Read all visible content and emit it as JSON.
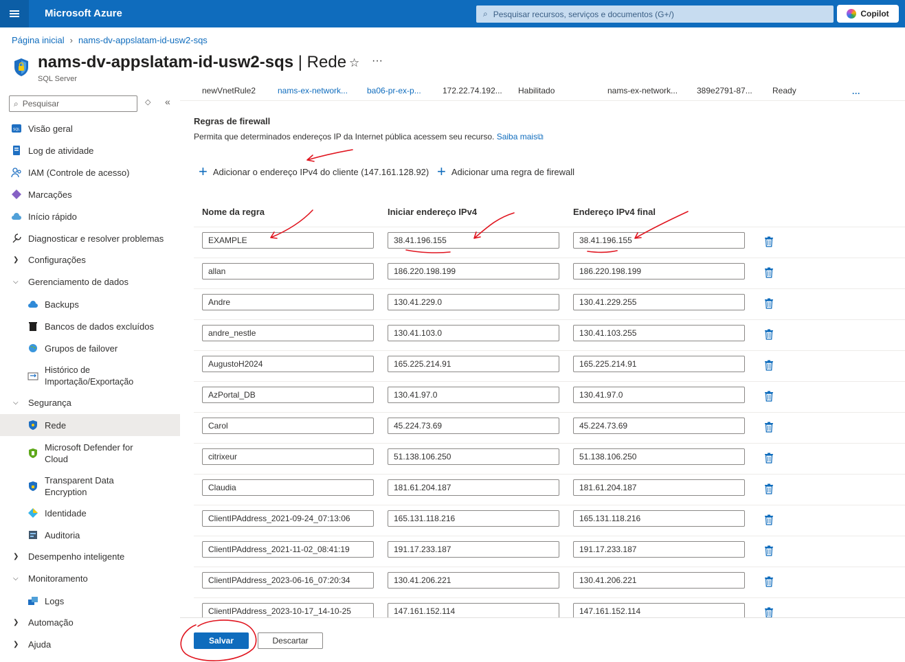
{
  "topbar": {
    "brand": "Microsoft Azure",
    "search_placeholder": "Pesquisar recursos, serviços e documentos (G+/)",
    "copilot_label": "Copilot"
  },
  "breadcrumb": {
    "home": "Página inicial",
    "current": "nams-dv-appslatam-id-usw2-sqs"
  },
  "header": {
    "resource_name": "nams-dv-appslatam-id-usw2-sqs",
    "page_name": "| Rede",
    "subtitle": "SQL Server",
    "star_icon": "☆",
    "more_icon": "···"
  },
  "sidebar": {
    "search_placeholder": "Pesquisar",
    "collapse_icon": "«",
    "items": [
      {
        "label": "Visão geral",
        "icon": "sql-icon"
      },
      {
        "label": "Log de atividade",
        "icon": "log-icon"
      },
      {
        "label": "IAM (Controle de acesso)",
        "icon": "people-icon"
      },
      {
        "label": "Marcações",
        "icon": "tag-icon"
      },
      {
        "label": "Início rápido",
        "icon": "cloud-icon"
      },
      {
        "label": "Diagnosticar e resolver problemas",
        "icon": "wrench-icon"
      },
      {
        "label": "Configurações",
        "icon": "chevron-right-icon"
      },
      {
        "label": "Gerenciamento de dados",
        "icon": "chevron-down-icon"
      },
      {
        "label": "Backups",
        "icon": "cloud-backup-icon"
      },
      {
        "label": "Bancos de dados excluídos",
        "icon": "trash-icon"
      },
      {
        "label": "Grupos de failover",
        "icon": "globe-icon"
      },
      {
        "label": "Histórico de\nImportação/Exportação",
        "icon": "import-export-icon"
      },
      {
        "label": "Segurança",
        "icon": "chevron-down-icon"
      },
      {
        "label": "Rede",
        "icon": "shield-icon"
      },
      {
        "label": "Microsoft Defender for\nCloud",
        "icon": "defender-icon"
      },
      {
        "label": "Transparent Data\nEncryption",
        "icon": "shield-lock-icon"
      },
      {
        "label": "Identidade",
        "icon": "identity-icon"
      },
      {
        "label": "Auditoria",
        "icon": "audit-icon"
      },
      {
        "label": "Desempenho inteligente",
        "icon": "chevron-right-icon"
      },
      {
        "label": "Monitoramento",
        "icon": "chevron-down-icon"
      },
      {
        "label": "Logs",
        "icon": "logs-icon"
      },
      {
        "label": "Automação",
        "icon": "chevron-right-icon"
      },
      {
        "label": "Ajuda",
        "icon": "chevron-right-icon"
      }
    ]
  },
  "vnet_row": {
    "name": "newVnetRule2",
    "vnet": "nams-ex-network...",
    "subnet": "ba06-pr-ex-p...",
    "address": "172.22.74.192...",
    "status": "Habilitado",
    "resource_group": "nams-ex-network...",
    "subscription": "389e2791-87...",
    "state": "Ready",
    "more": "···"
  },
  "firewall": {
    "title": "Regras de firewall",
    "description": "Permita que determinados endereços IP da Internet pública acessem seu recurso.",
    "learn_more": "Saiba mais",
    "add_client_ip": "Adicionar o endereço IPv4 do cliente (147.161.128.92)",
    "add_rule": "Adicionar uma regra de firewall",
    "col_name": "Nome da regra",
    "col_start": "Iniciar endereço IPv4",
    "col_end": "Endereço IPv4 final",
    "rules": [
      {
        "name": "EXAMPLE",
        "start": "38.41.196.155",
        "end": "38.41.196.155"
      },
      {
        "name": "allan",
        "start": "186.220.198.199",
        "end": "186.220.198.199"
      },
      {
        "name": "Andre",
        "start": "130.41.229.0",
        "end": "130.41.229.255"
      },
      {
        "name": "andre_nestle",
        "start": "130.41.103.0",
        "end": "130.41.103.255"
      },
      {
        "name": "AugustoH2024",
        "start": "165.225.214.91",
        "end": "165.225.214.91"
      },
      {
        "name": "AzPortal_DB",
        "start": "130.41.97.0",
        "end": "130.41.97.0"
      },
      {
        "name": "Carol",
        "start": "45.224.73.69",
        "end": "45.224.73.69"
      },
      {
        "name": "citrixeur",
        "start": "51.138.106.250",
        "end": "51.138.106.250"
      },
      {
        "name": "Claudia",
        "start": "181.61.204.187",
        "end": "181.61.204.187"
      },
      {
        "name": "ClientIPAddress_2021-09-24_07:13:06",
        "start": "165.131.118.216",
        "end": "165.131.118.216"
      },
      {
        "name": "ClientIPAddress_2021-11-02_08:41:19",
        "start": "191.17.233.187",
        "end": "191.17.233.187"
      },
      {
        "name": "ClientIPAddress_2023-06-16_07:20:34",
        "start": "130.41.206.221",
        "end": "130.41.206.221"
      },
      {
        "name": "ClientIPAddress_2023-10-17_14-10-25",
        "start": "147.161.152.114",
        "end": "147.161.152.114"
      }
    ]
  },
  "footer": {
    "save": "Salvar",
    "discard": "Descartar"
  },
  "colors": {
    "accent": "#0f6cbd",
    "annotation": "#e0141e"
  }
}
